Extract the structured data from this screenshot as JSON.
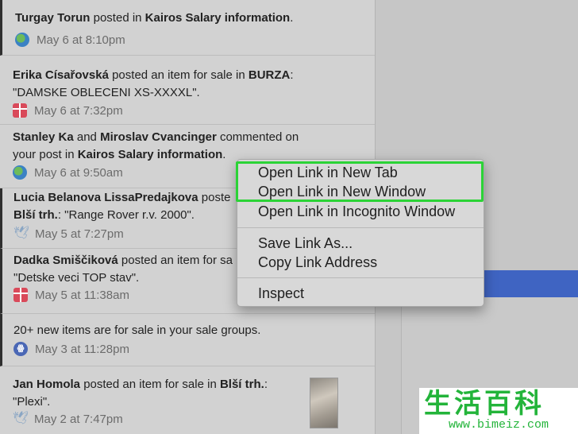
{
  "notifications": [
    {
      "actor": "Turgay Torun",
      "verb": " posted in ",
      "target": "Kairos Salary information",
      "tail": ".",
      "extra": "",
      "time": "May 6 at 8:10pm",
      "icon": "globe-icon"
    },
    {
      "actor": "Erika Císařovská",
      "verb": " posted an item for sale in ",
      "target": "BURZA",
      "tail": ":",
      "extra": "\"DAMSKE OBLECENI XS-XXXXL\".",
      "time": "May 6 at 7:32pm",
      "icon": "gift-icon"
    },
    {
      "actor": "Stanley Ka",
      "verb": " and ",
      "actor2": "Miroslav Cvancinger",
      "verb2": " commented on your post in ",
      "target": "Kairos Salary information",
      "tail": ".",
      "time": "May 6 at 9:50am",
      "icon": "globe-icon"
    },
    {
      "actor": "Lucia Belanova LissaPredajkova",
      "verb": " poste",
      "target": "Blší trh.",
      "tail": ": \"Range Rover r.v. 2000\".",
      "time": "May 5 at 7:27pm",
      "icon": "bird-icon"
    },
    {
      "actor": "Dadka Smiščiková",
      "verb": " posted an item for sa",
      "extra": "\"Detske veci TOP stav\".",
      "time": "May 5 at 11:38am",
      "icon": "gift-icon"
    },
    {
      "text": "20+ new items are for sale in your sale groups.",
      "time": "May 3 at 11:28pm",
      "icon": "group-icon",
      "icon_text": "ꙮ"
    },
    {
      "actor": "Jan Homola",
      "verb": " posted an item for sale in ",
      "target": "Blší trh.",
      "tail": ":",
      "extra": "\"Plexi\".",
      "time": "May 2 at 7:47pm",
      "icon": "bird-icon"
    }
  ],
  "context_menu": {
    "items": [
      "Open Link in New Tab",
      "Open Link in New Window",
      "Open Link in Incognito Window",
      "Save Link As...",
      "Copy Link Address",
      "Inspect"
    ]
  },
  "watermark": {
    "chinese": "生活百科",
    "url": "www.bimeiz.com"
  },
  "colors": {
    "highlight": "#2bd336",
    "menu_bg": "#d8d8d8",
    "panel_bg": "#d2d2d2",
    "accent_blue": "#3f64c2"
  }
}
